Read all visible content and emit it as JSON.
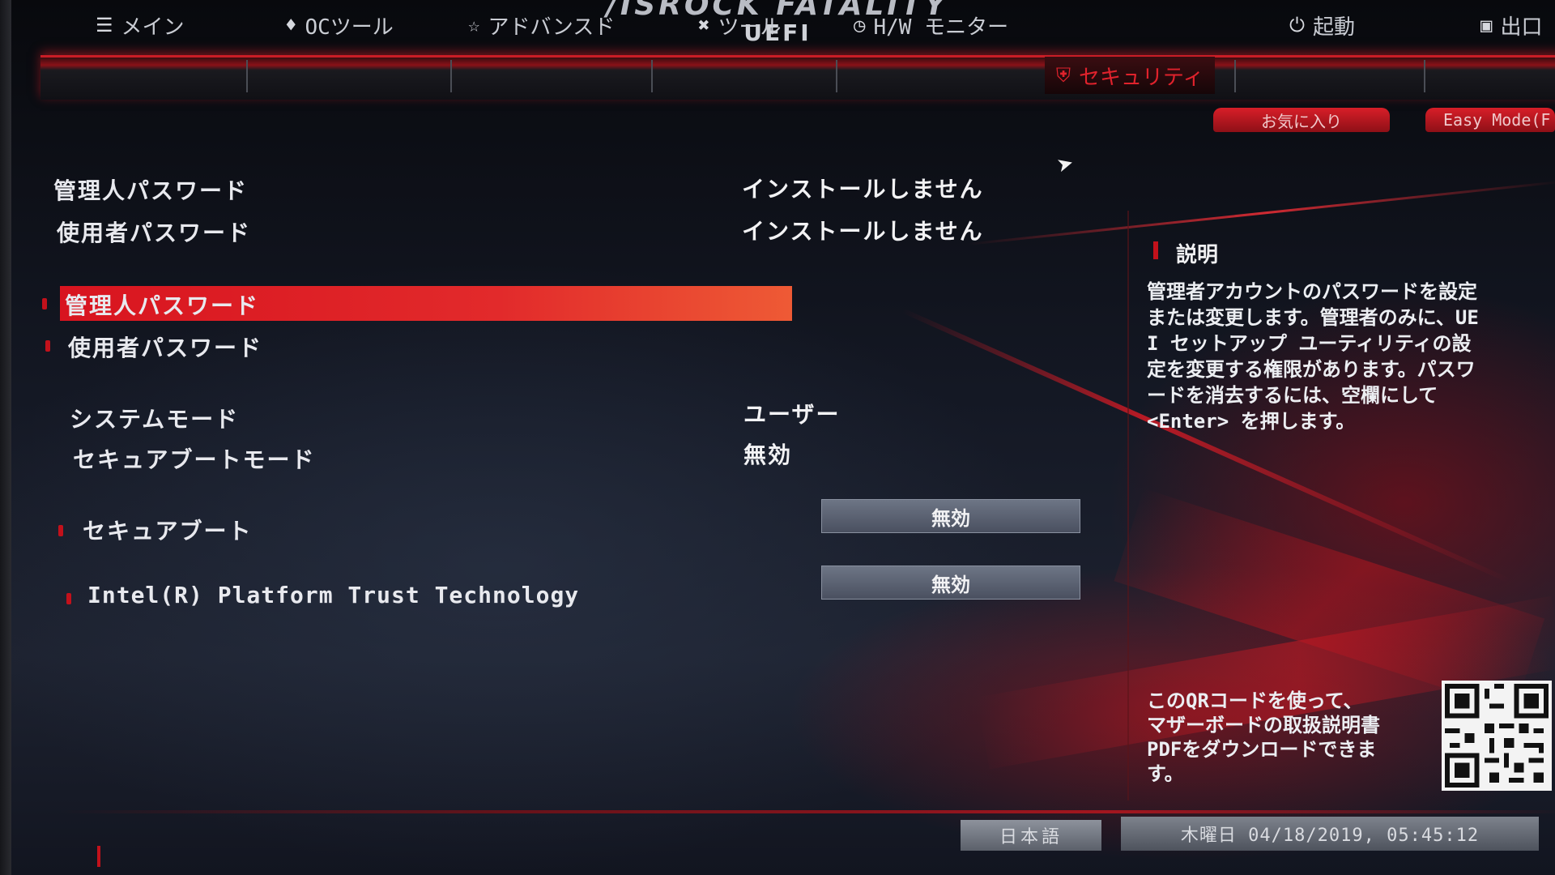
{
  "header": {
    "brand": "/ISROCK FATALITY",
    "subtitle": "UEFI"
  },
  "tabs": [
    {
      "icon": "list-icon",
      "label": "メイン",
      "active": false
    },
    {
      "icon": "rocket-icon",
      "label": "OCツール",
      "active": false
    },
    {
      "icon": "star-icon",
      "label": "アドバンスド",
      "active": false
    },
    {
      "icon": "tools-icon",
      "label": "ツール",
      "active": false
    },
    {
      "icon": "gauge-icon",
      "label": "H/W モニター",
      "active": false
    },
    {
      "icon": "shield-icon",
      "label": "セキュリティ",
      "active": true
    },
    {
      "icon": "power-icon",
      "label": "起動",
      "active": false
    },
    {
      "icon": "exit-icon",
      "label": "出口",
      "active": false
    }
  ],
  "quick": {
    "favorites": "お気に入り",
    "easy_mode": "Easy Mode(F"
  },
  "status": {
    "admin_password_label": "管理人パスワード",
    "admin_password_value": "インストールしません",
    "user_password_label": "使用者パスワード",
    "user_password_value": "インストールしません"
  },
  "settings": {
    "admin_password": "管理人パスワード",
    "user_password": "使用者パスワード",
    "system_mode_label": "システムモード",
    "system_mode_value": "ユーザー",
    "secure_boot_mode_label": "セキュアブートモード",
    "secure_boot_mode_value": "無効",
    "secure_boot_label": "セキュアブート",
    "secure_boot_value": "無効",
    "ptt_label": "Intel(R) Platform Trust Technology",
    "ptt_value": "無効"
  },
  "help": {
    "title": "説明",
    "text": "管理者アカウントのパスワードを設定\nまたは変更します。管理者のみに、UE\nI セットアップ ユーティリティの設\n定を変更する権限があります。パスワ\nードを消去するには、空欄にして\n<Enter> を押します。",
    "qr_text": "このQRコードを使って、\nマザーボードの取扱説明書\nPDFをダウンロードできま\nす。"
  },
  "footer": {
    "language": "日本語",
    "datetime": "木曜日 04/18/2019, 05:45:12"
  },
  "colors": {
    "accent": "#e0222c",
    "highlight": "#d8141f",
    "button": "#5b6272"
  }
}
